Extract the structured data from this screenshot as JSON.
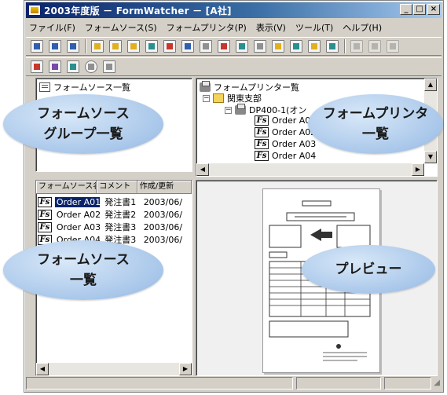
{
  "window": {
    "title": "2003年度版 － FormWatcher － [A社]",
    "controls": {
      "minimize": "_",
      "maximize": "□",
      "close": "×"
    }
  },
  "menubar": {
    "items": [
      "ファイル(F)",
      "フォームソース(S)",
      "フォームプリンタ(P)",
      "表示(V)",
      "ツール(T)",
      "ヘルプ(H)"
    ]
  },
  "toolbar1": {
    "icons": [
      "form-new-icon",
      "form-open-icon",
      "save-icon",
      "form-edit-icon",
      "form-copy-icon",
      "form-add-icon",
      "form-group-icon",
      "form-delete-icon",
      "preview-icon",
      "printer-copy-icon",
      "printer-send-icon",
      "properties-icon",
      "cut-icon",
      "copy-icon",
      "paste-icon",
      "open-folder-icon",
      "export-icon",
      "disabled-print-icon",
      "disabled-cache-icon",
      "disabled-share-icon",
      "disabled-send-icon"
    ]
  },
  "toolbar2": {
    "icons": [
      "printer-add-icon",
      "printer-refresh-icon",
      "printer-setting-icon",
      "stop-icon",
      "log-icon"
    ]
  },
  "source_group_panel": {
    "title": "フォームソース一覧",
    "callout": [
      "フォームソース",
      "グループ一覧"
    ]
  },
  "printer_panel": {
    "title": "フォームプリンター覧",
    "tree": {
      "group": "関東支部",
      "printer": "DP400-1(オン",
      "forms": [
        "Order A01",
        "Order A02",
        "Order A03",
        "Order A04"
      ]
    },
    "callout": [
      "フォームプリンタ",
      "一覧"
    ]
  },
  "form_list": {
    "columns": [
      "フォームソース名",
      "コメント",
      "作成/更新"
    ],
    "rows": [
      {
        "name": "Order A01",
        "comment": "発注書1",
        "date": "2003/06/",
        "selected": true
      },
      {
        "name": "Order A02",
        "comment": "発注書2",
        "date": "2003/06/",
        "selected": false
      },
      {
        "name": "Order A03",
        "comment": "発注書3",
        "date": "2003/06/",
        "selected": false
      },
      {
        "name": "Order A04",
        "comment": "発注書3",
        "date": "2003/06/",
        "selected": false
      }
    ],
    "callout": [
      "フォームソース",
      "一覧"
    ]
  },
  "preview_panel": {
    "callout": "プレビュー"
  },
  "colors": {
    "titlebar_start": "#0a246a",
    "titlebar_end": "#a6caf0",
    "face": "#d4d0c8",
    "selection": "#0a246a",
    "callout": "#a9c7ea"
  }
}
